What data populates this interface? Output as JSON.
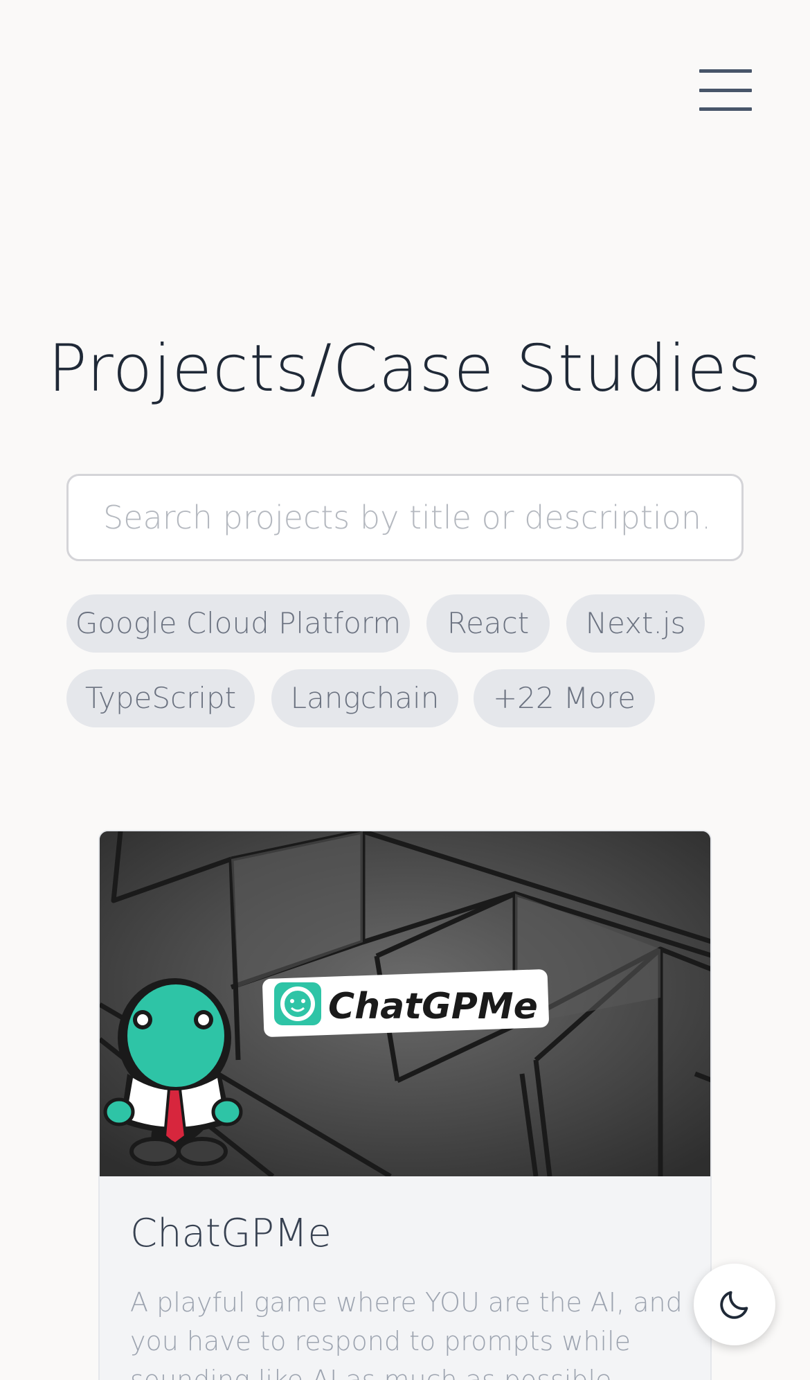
{
  "header": {
    "menu_icon": "hamburger-menu-icon"
  },
  "page": {
    "title": "Projects/Case Studies"
  },
  "search": {
    "placeholder": "Search projects by title or description...",
    "value": ""
  },
  "tags": [
    {
      "label": "Google Cloud Platform"
    },
    {
      "label": "React"
    },
    {
      "label": "Next.js"
    },
    {
      "label": "TypeScript"
    },
    {
      "label": "Langchain"
    },
    {
      "label": "+22 More"
    }
  ],
  "projects": [
    {
      "title": "ChatGPMe",
      "image_text": "ChatGPMe",
      "description": "A playful game where YOU are the AI, and you have to respond to prompts while sounding like AI as much as possible."
    }
  ],
  "theme_toggle": {
    "icon": "moon-icon"
  },
  "colors": {
    "accent_teal": "#2ec4a6",
    "tie_red": "#d7263d"
  }
}
